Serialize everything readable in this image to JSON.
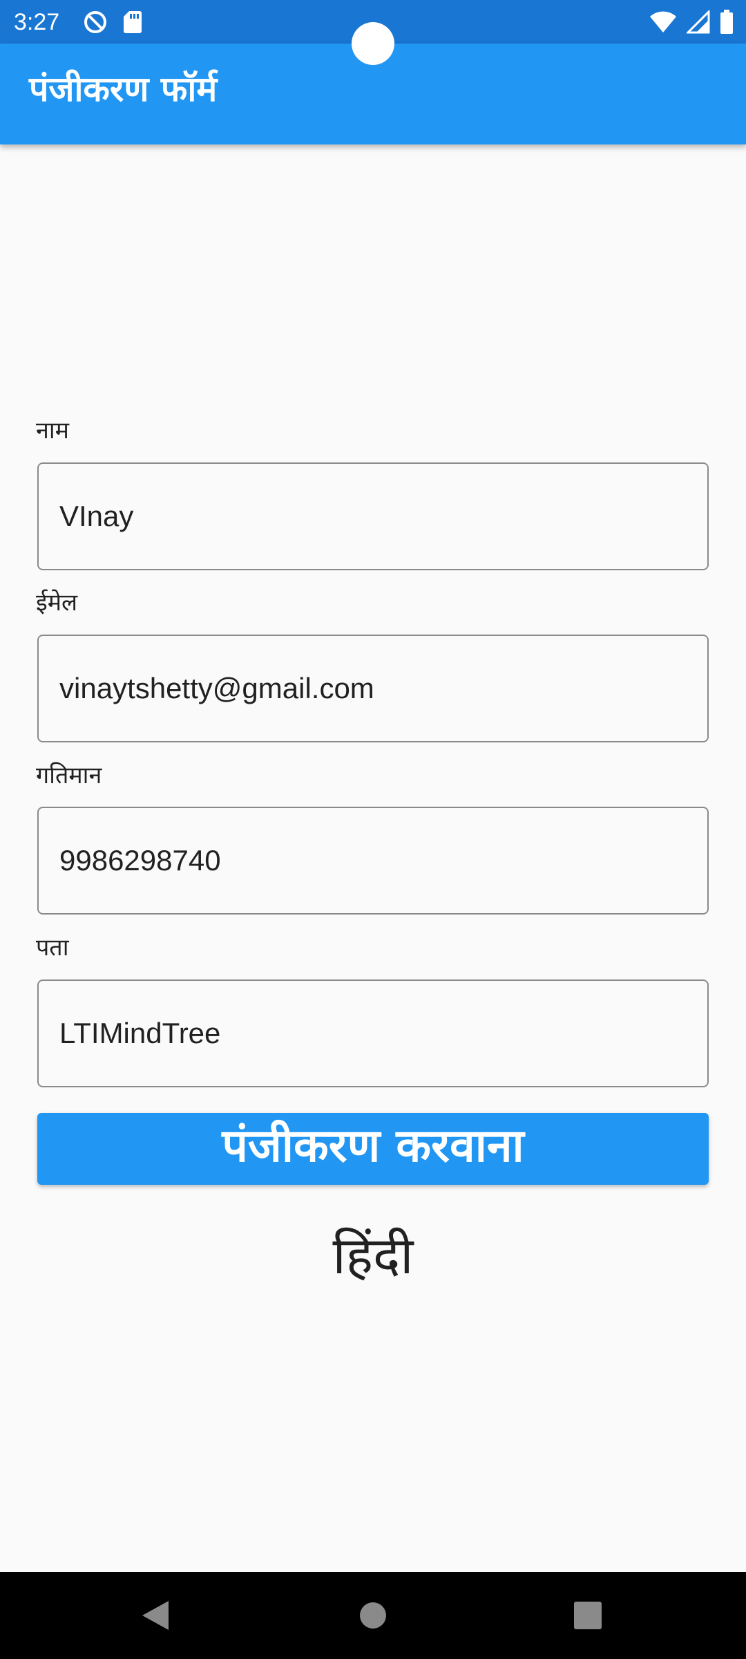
{
  "status_bar": {
    "time": "3:27",
    "left_icons": [
      "do-not-disturb-icon",
      "sd-card-icon"
    ],
    "right_icons": [
      "wifi-icon",
      "cellular-signal-icon",
      "battery-icon"
    ]
  },
  "app_bar": {
    "title": "पंजीकरण फॉर्म",
    "color": "#2196f3"
  },
  "form": {
    "fields": [
      {
        "label": "नाम",
        "value": "VInay"
      },
      {
        "label": "ईमेल",
        "value": "vinaytshetty@gmail.com"
      },
      {
        "label": "गतिमान",
        "value": "9986298740"
      },
      {
        "label": "पता",
        "value": "LTIMindTree"
      }
    ],
    "submit_label": "पंजीकरण करवाना"
  },
  "language_label": "हिंदी",
  "nav_bar": {
    "buttons": [
      "back-icon",
      "home-icon",
      "recents-icon"
    ]
  }
}
